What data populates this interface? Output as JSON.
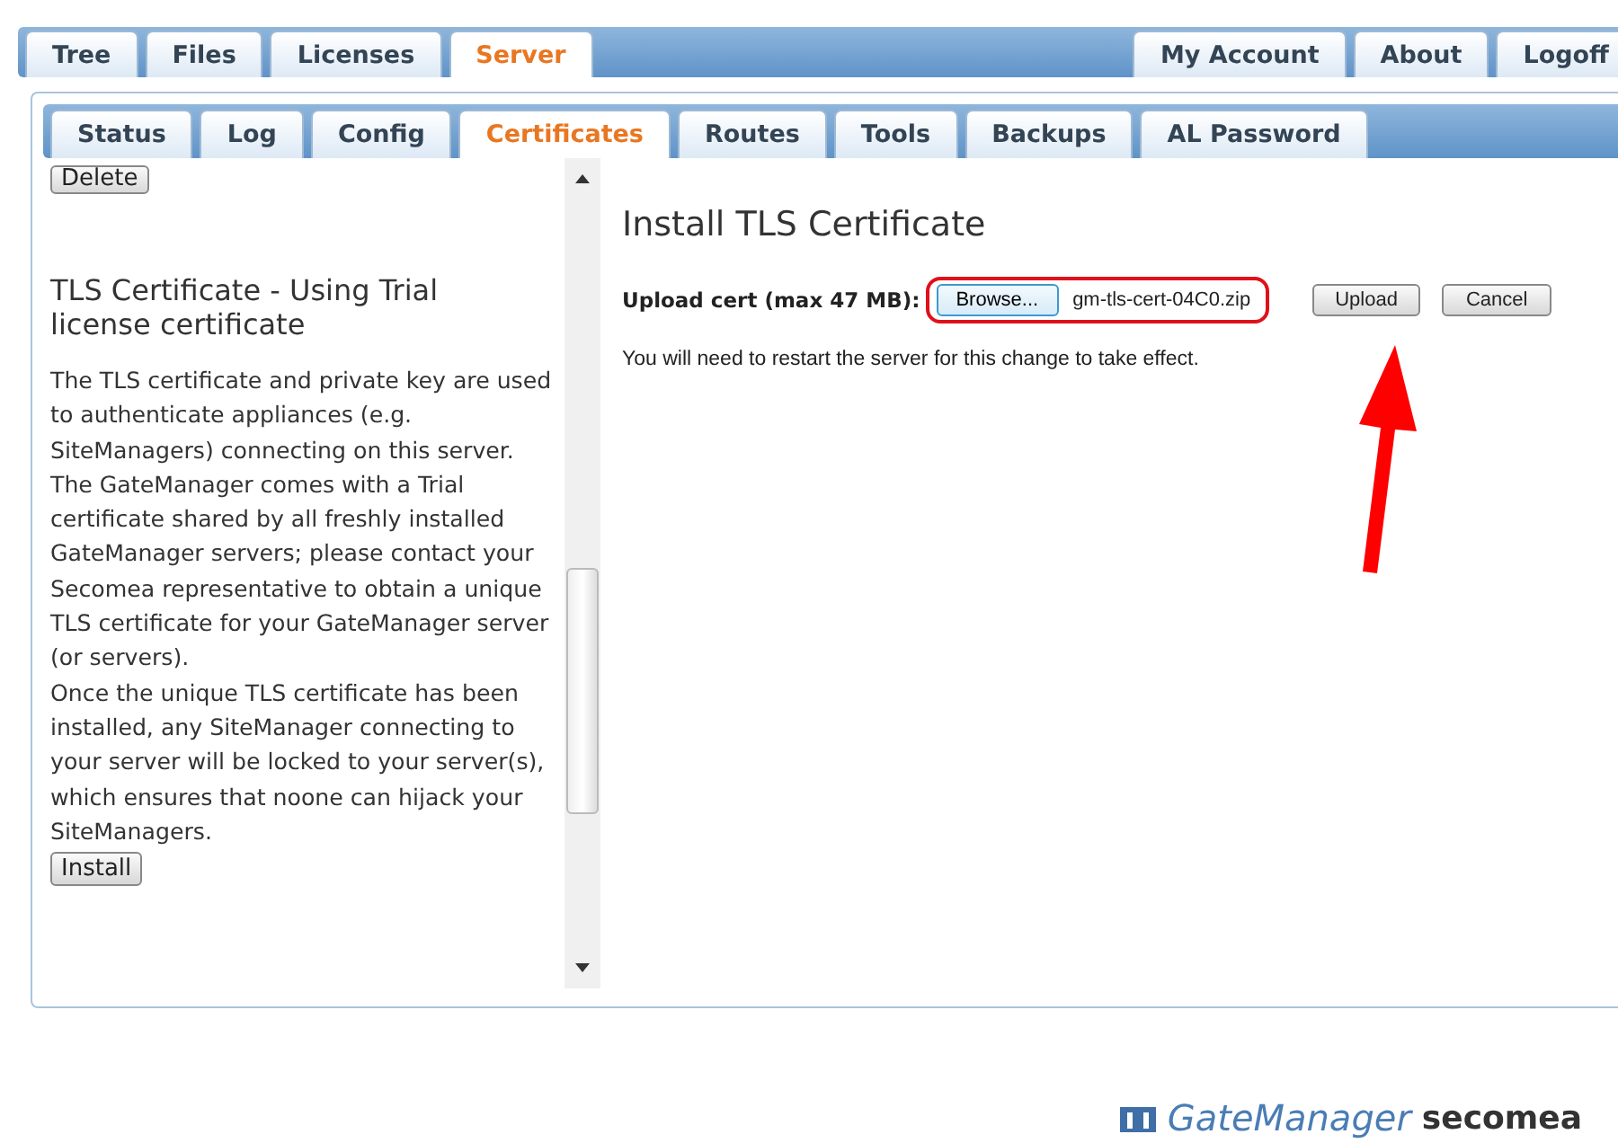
{
  "main_tabs_left": [
    {
      "label": "Tree",
      "selected": false
    },
    {
      "label": "Files",
      "selected": false
    },
    {
      "label": "Licenses",
      "selected": false
    },
    {
      "label": "Server",
      "selected": true
    }
  ],
  "main_tabs_right": [
    {
      "label": "My Account",
      "selected": false
    },
    {
      "label": "About",
      "selected": false
    },
    {
      "label": "Logoff",
      "selected": false
    }
  ],
  "sub_tabs": [
    {
      "label": "Status",
      "selected": false
    },
    {
      "label": "Log",
      "selected": false
    },
    {
      "label": "Config",
      "selected": false
    },
    {
      "label": "Certificates",
      "selected": true
    },
    {
      "label": "Routes",
      "selected": false
    },
    {
      "label": "Tools",
      "selected": false
    },
    {
      "label": "Backups",
      "selected": false
    },
    {
      "label": "AL Password",
      "selected": false
    }
  ],
  "left_pane": {
    "top_button": "Delete",
    "heading": "TLS Certificate - Using Trial license certificate",
    "paragraph": "The TLS certificate and private key are used to authenticate appliances (e.g. SiteManagers) connecting on this server. The GateManager comes with a Trial certificate shared by all freshly installed GateManager servers; please contact your\nSecomea representative to obtain a unique TLS certificate for your GateManager server (or servers).\nOnce the unique TLS certificate has been installed, any SiteManager connecting to your server will be locked to your server(s), which ensures that noone can hijack your SiteManagers.",
    "install_button": "Install"
  },
  "right_pane": {
    "title": "Install TLS Certificate",
    "upload_label": "Upload cert (max 47 MB):",
    "browse_button": "Browse...",
    "file_name": "gm-tls-cert-04C0.zip",
    "upload_button": "Upload",
    "cancel_button": "Cancel",
    "note": "You will need to restart the server for this change to take effect."
  },
  "footer": {
    "product": "GateManager",
    "brand": "secomea"
  }
}
